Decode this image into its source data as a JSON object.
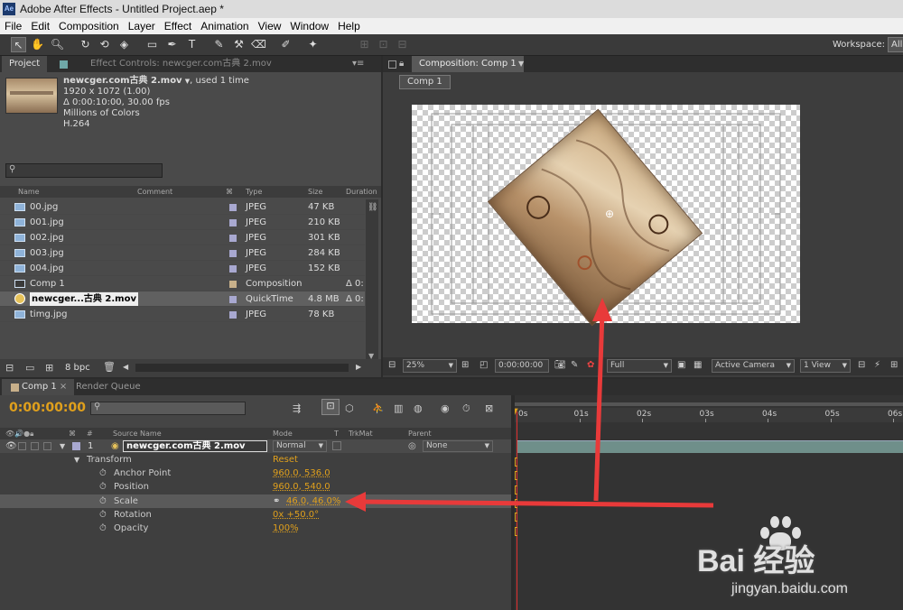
{
  "app": {
    "title": "Adobe After Effects - Untitled Project.aep *",
    "icon_text": "Ae"
  },
  "menu": [
    "File",
    "Edit",
    "Composition",
    "Layer",
    "Effect",
    "Animation",
    "View",
    "Window",
    "Help"
  ],
  "workspace": {
    "label": "Workspace:",
    "value": "All"
  },
  "project_panel": {
    "tab_project": "Project",
    "tab_effect_controls": "Effect Controls: newcger.com古典 2.mov",
    "selected_item": {
      "name": "newcger.com古典 2.mov",
      "usage": ", used 1 time",
      "dimensions": "1920 x 1072 (1.00)",
      "duration": "Δ 0:00:10:00, 30.00 fps",
      "colors": "Millions of Colors",
      "codec": "H.264"
    },
    "search_placeholder": "",
    "columns": [
      "Name",
      "Comment",
      "Type",
      "Size",
      "Duration"
    ],
    "items": [
      {
        "name": "00.jpg",
        "type": "JPEG",
        "size": "47 KB",
        "duration": "",
        "color": "#a8a8d0",
        "icon": "image-icon"
      },
      {
        "name": "001.jpg",
        "type": "JPEG",
        "size": "210 KB",
        "duration": "",
        "color": "#a8a8d0",
        "icon": "image-icon"
      },
      {
        "name": "002.jpg",
        "type": "JPEG",
        "size": "301 KB",
        "duration": "",
        "color": "#a8a8d0",
        "icon": "image-icon"
      },
      {
        "name": "003.jpg",
        "type": "JPEG",
        "size": "284 KB",
        "duration": "",
        "color": "#a8a8d0",
        "icon": "image-icon"
      },
      {
        "name": "004.jpg",
        "type": "JPEG",
        "size": "152 KB",
        "duration": "",
        "color": "#a8a8d0",
        "icon": "image-icon"
      },
      {
        "name": "Comp 1",
        "type": "Composition",
        "size": "",
        "duration": "Δ 0:",
        "color": "#c8b08a",
        "icon": "composition-icon"
      },
      {
        "name": "newcger...古典 2.mov",
        "type": "QuickTime",
        "size": "4.8 MB",
        "duration": "Δ 0:",
        "color": "#a8a8d0",
        "icon": "quicktime-icon",
        "selected": true
      },
      {
        "name": "timg.jpg",
        "type": "JPEG",
        "size": "78 KB",
        "duration": "",
        "color": "#a8a8d0",
        "icon": "image-icon"
      }
    ],
    "bpc": "8 bpc"
  },
  "comp_viewer": {
    "tab": "Composition: Comp 1",
    "breadcrumb": "Comp 1",
    "zoom": "25%",
    "timecode": "0:00:00:00",
    "resolution": "Full",
    "camera": "Active Camera",
    "view": "1 View"
  },
  "timeline": {
    "tab_comp": "Comp 1",
    "tab_render": "Render Queue",
    "timecode": "0:00:00:00",
    "columns": {
      "num": "#",
      "source": "Source Name",
      "mode": "Mode",
      "t": "T",
      "trkmat": "TrkMat",
      "parent": "Parent"
    },
    "ruler": [
      "0s",
      "01s",
      "02s",
      "03s",
      "04s",
      "05s",
      "06s"
    ],
    "layer": {
      "index": "1",
      "name": "newcger.com古典 2.mov",
      "mode": "Normal",
      "parent": "None"
    },
    "transform": {
      "label": "Transform",
      "reset": "Reset"
    },
    "properties": [
      {
        "name": "Anchor Point",
        "value": "960.0, 536.0"
      },
      {
        "name": "Position",
        "value": "960.0, 540.0"
      },
      {
        "name": "Scale",
        "value": "46.0, 46.0%"
      },
      {
        "name": "Rotation",
        "value": "0x +50.0°"
      },
      {
        "name": "Opacity",
        "value": "100%"
      }
    ]
  },
  "watermark": {
    "brand": "Bai 经验",
    "url": "jingyan.baidu.com"
  },
  "colors": {
    "accent": "#e0a01c",
    "annotation_arrow": "#e83a3a",
    "panel": "#4a4a4a"
  }
}
